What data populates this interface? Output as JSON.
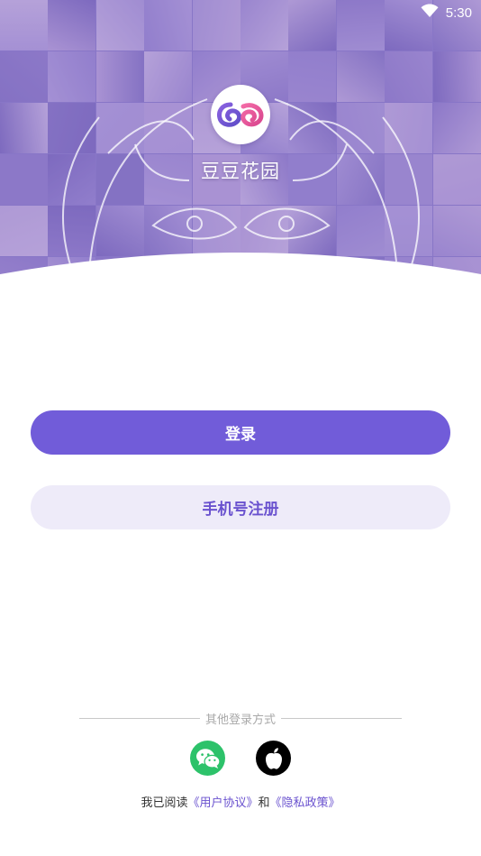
{
  "status_bar": {
    "time": "5:30",
    "wifi_icon": "wifi-icon"
  },
  "hero": {
    "app_name": "豆豆花园",
    "logo_icon": "app-logo-icon"
  },
  "actions": {
    "login_label": "登录",
    "register_label": "手机号注册"
  },
  "other_login": {
    "label": "其他登录方式",
    "wechat_icon": "wechat-icon",
    "apple_icon": "apple-icon"
  },
  "agreement": {
    "prefix": "我已阅读",
    "user_agreement": "《用户协议》",
    "conjunction": "和",
    "privacy_policy": "《隐私政策》"
  },
  "colors": {
    "primary": "#715cd9",
    "primary_light": "#eeebf9",
    "link": "#6a52cf",
    "wechat": "#2dc26a",
    "hero_tint": "#8f7fc4"
  }
}
